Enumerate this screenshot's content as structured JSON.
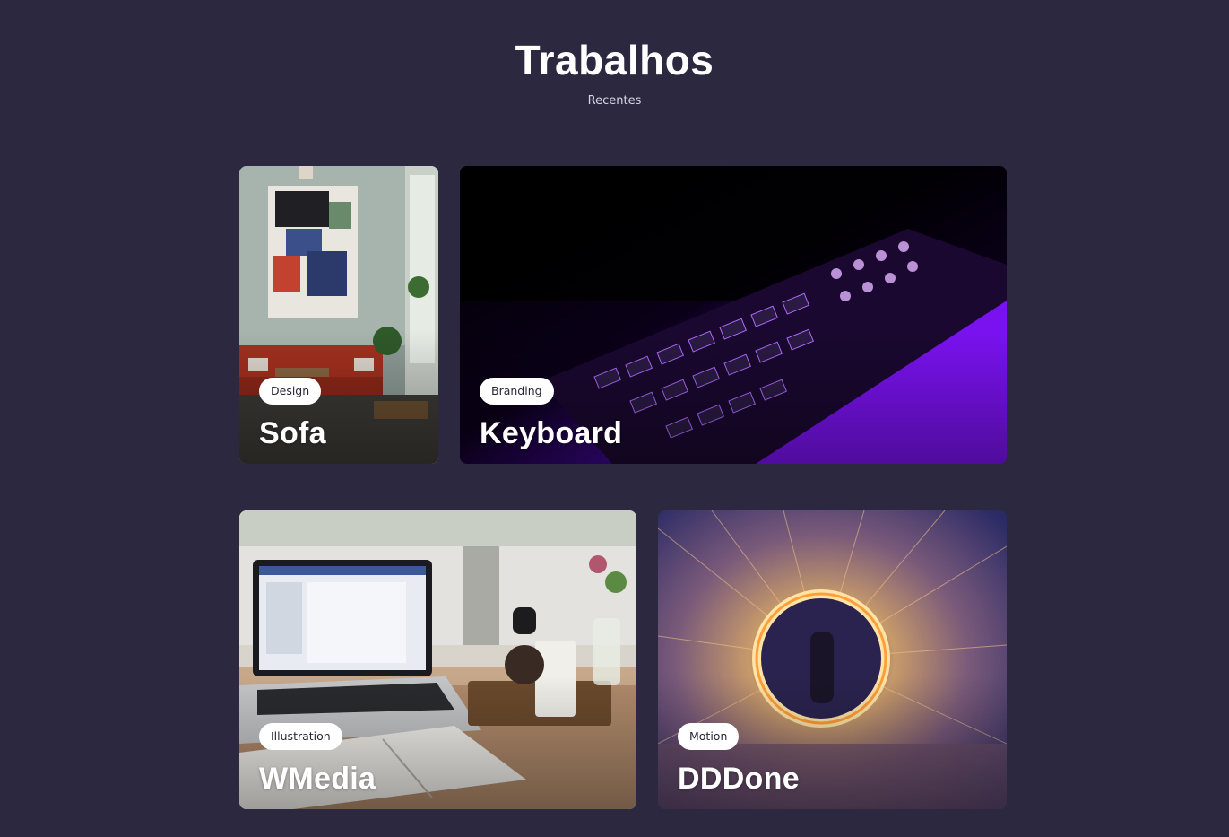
{
  "header": {
    "title": "Trabalhos",
    "subtitle": "Recentes"
  },
  "projects": [
    {
      "tag": "Design",
      "title": "Sofa",
      "image": "cafe-interior-red-sofa-painting"
    },
    {
      "tag": "Branding",
      "title": "Keyboard",
      "image": "backlit-keyboard-purple-light"
    },
    {
      "tag": "Illustration",
      "title": "WMedia",
      "image": "laptop-notebook-coffee-desk"
    },
    {
      "tag": "Motion",
      "title": "DDDone",
      "image": "steel-wool-light-circle"
    }
  ],
  "colors": {
    "background": "#2c2840",
    "tag_bg": "#ffffff",
    "tag_text": "#2a2638",
    "title_text": "#ffffff"
  }
}
